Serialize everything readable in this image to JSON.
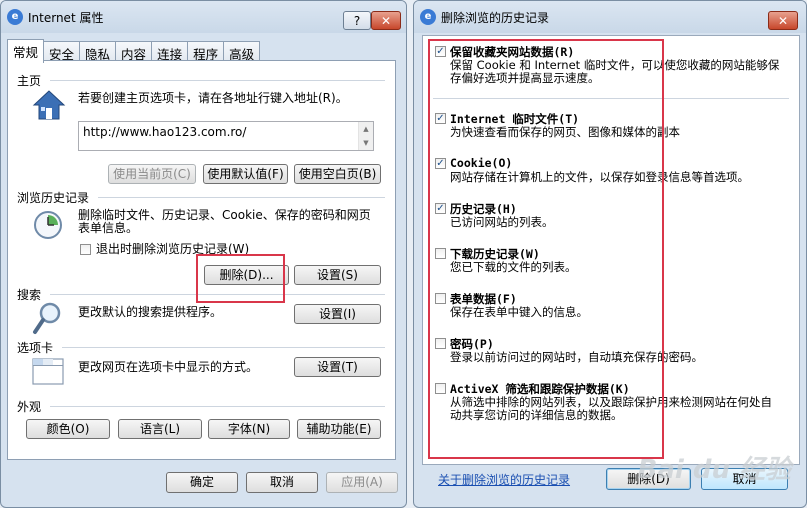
{
  "left_window": {
    "title": "Internet 属性",
    "help_label": "?",
    "close_label": "✕",
    "tabs": [
      "常规",
      "安全",
      "隐私",
      "内容",
      "连接",
      "程序",
      "高级"
    ],
    "home": {
      "section": "主页",
      "desc": "若要创建主页选项卡，请在各地址行键入地址(R)。",
      "url": "http://www.hao123.com.ro/",
      "btn_current": "使用当前页(C)",
      "btn_default": "使用默认值(F)",
      "btn_blank": "使用空白页(B)"
    },
    "history": {
      "section": "浏览历史记录",
      "desc_line1": "删除临时文件、历史记录、Cookie、保存的密码和网页",
      "desc_line2": "表单信息。",
      "checkbox_label": "退出时删除浏览历史记录(W)",
      "btn_delete": "删除(D)...",
      "btn_settings": "设置(S)"
    },
    "search": {
      "section": "搜索",
      "desc": "更改默认的搜索提供程序。",
      "btn_settings": "设置(I)"
    },
    "tabs_section": {
      "section": "选项卡",
      "desc": "更改网页在选项卡中显示的方式。",
      "btn_settings": "设置(T)"
    },
    "appearance": {
      "section": "外观",
      "btn_colors": "颜色(O)",
      "btn_languages": "语言(L)",
      "btn_fonts": "字体(N)",
      "btn_accessibility": "辅助功能(E)"
    },
    "footer": {
      "ok": "确定",
      "cancel": "取消",
      "apply": "应用(A)"
    }
  },
  "right_window": {
    "title": "删除浏览的历史记录",
    "close_label": "✕",
    "options": [
      {
        "title": "保留收藏夹网站数据(R)",
        "desc_line1": "保留 Cookie 和 Internet 临时文件，可以使您收藏的网站能够保",
        "desc_line2": "存偏好选项并提高显示速度。",
        "checked": true
      },
      {
        "title": "Internet 临时文件(T)",
        "desc_line1": "为快速查看而保存的网页、图像和媒体的副本",
        "desc_line2": "",
        "checked": true
      },
      {
        "title": "Cookie(O)",
        "desc_line1": "网站存储在计算机上的文件，以保存如登录信息等首选项。",
        "desc_line2": "",
        "checked": true
      },
      {
        "title": "历史记录(H)",
        "desc_line1": "已访问网站的列表。",
        "desc_line2": "",
        "checked": true
      },
      {
        "title": "下载历史记录(W)",
        "desc_line1": "您已下载的文件的列表。",
        "desc_line2": "",
        "checked": false
      },
      {
        "title": "表单数据(F)",
        "desc_line1": "保存在表单中键入的信息。",
        "desc_line2": "",
        "checked": false
      },
      {
        "title": "密码(P)",
        "desc_line1": "登录以前访问过的网站时，自动填充保存的密码。",
        "desc_line2": "",
        "checked": false
      },
      {
        "title": "ActiveX 筛选和跟踪保护数据(K)",
        "desc_line1": "从筛选中排除的网站列表，以及跟踪保护用来检测网站在何处自",
        "desc_line2": "动共享您访问的详细信息的数据。",
        "checked": false
      }
    ],
    "link": "关于删除浏览的历史记录",
    "btn_delete": "删除(D)",
    "btn_cancel": "取消"
  },
  "watermark": "Bai du 经验",
  "colors": {
    "highlight_red": "#d9364a",
    "link_blue": "#1a4fb1"
  }
}
